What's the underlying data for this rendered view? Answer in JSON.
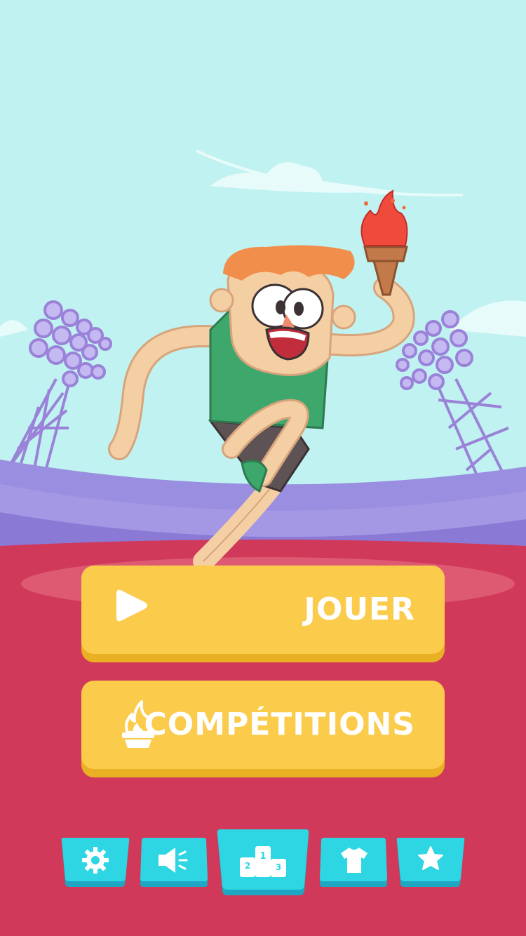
{
  "menu": {
    "play_label": "JOUER",
    "competitions_label": "COMPÉTITIONS"
  },
  "toolbar": {
    "items": [
      {
        "name": "settings",
        "icon": "gear-icon"
      },
      {
        "name": "sound",
        "icon": "speaker-icon"
      },
      {
        "name": "leaderboard",
        "icon": "podium-icon",
        "podium_labels": [
          "1",
          "2",
          "3"
        ]
      },
      {
        "name": "outfits",
        "icon": "shirt-icon"
      },
      {
        "name": "rate",
        "icon": "star-icon"
      }
    ]
  },
  "colors": {
    "sky": "#bff2f0",
    "stands": "#9b8fe0",
    "track": "#d0395a",
    "button_yellow": "#fbcc4b",
    "button_shadow": "#e9b024",
    "toolbar_cyan": "#2dd6e2",
    "toolbar_shadow": "#1fa6c2"
  }
}
